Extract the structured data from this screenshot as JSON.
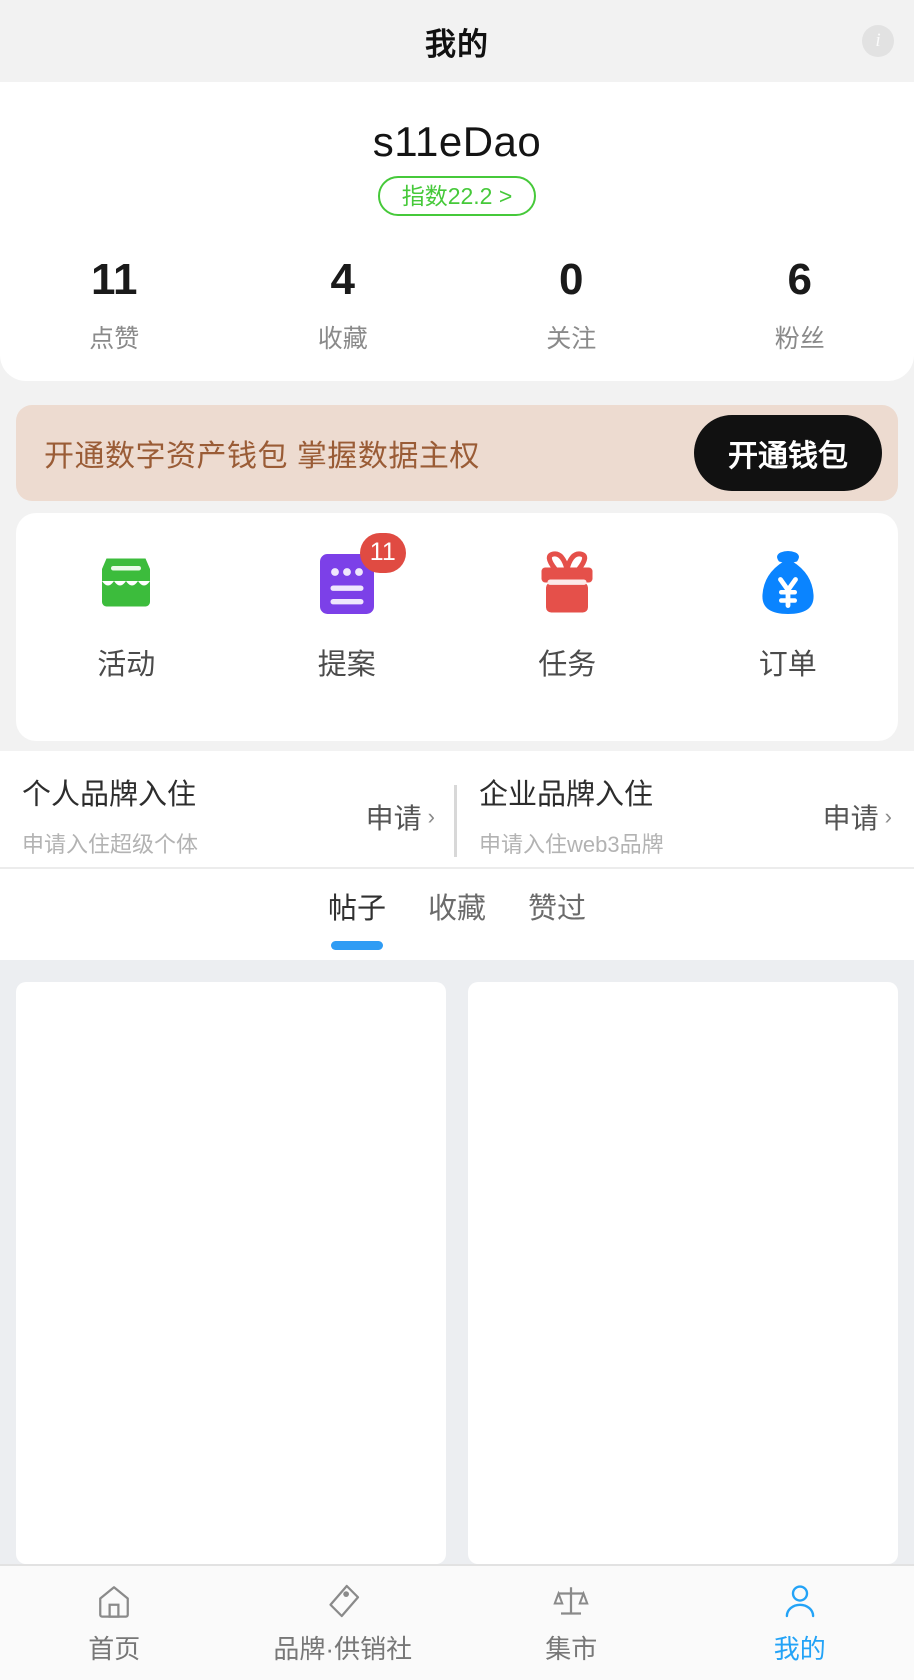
{
  "header": {
    "title": "我的",
    "info_icon": "info-icon"
  },
  "profile": {
    "username": "s11eDao",
    "index_badge": "指数22.2 >",
    "stats": [
      {
        "value": "11",
        "label": "点赞"
      },
      {
        "value": "4",
        "label": "收藏"
      },
      {
        "value": "0",
        "label": "关注"
      },
      {
        "value": "6",
        "label": "粉丝"
      }
    ]
  },
  "wallet_banner": {
    "text": "开通数字资产钱包 掌握数据主权",
    "button": "开通钱包",
    "bg_color": "#eddbd0",
    "text_color": "#9a5c36",
    "button_color": "#111111"
  },
  "quick_entries": [
    {
      "label": "活动",
      "icon": "store-icon",
      "color": "#3cbc3c",
      "badge": ""
    },
    {
      "label": "提案",
      "icon": "document-icon",
      "color": "#7c40e8",
      "badge": "11"
    },
    {
      "label": "任务",
      "icon": "gift-icon",
      "color": "#e5504a",
      "badge": ""
    },
    {
      "label": "订单",
      "icon": "money-bag-icon",
      "color": "#0a84ff",
      "badge": ""
    }
  ],
  "brand_entries": [
    {
      "title": "个人品牌入住",
      "subtitle": "申请入住超级个体",
      "apply_label": "申请",
      "chevron": "›"
    },
    {
      "title": "企业品牌入住",
      "subtitle": "申请入住web3品牌",
      "apply_label": "申请",
      "chevron": "›"
    }
  ],
  "tabs": [
    {
      "label": "帖子",
      "active": true
    },
    {
      "label": "收藏",
      "active": false
    },
    {
      "label": "赞过",
      "active": false
    }
  ],
  "tab_accent_color": "#2f9cf4",
  "content_cards": [
    {
      "placeholder": ""
    },
    {
      "placeholder": ""
    }
  ],
  "bottom_nav": {
    "active_color": "#23a3f7",
    "items": [
      {
        "label": "首页",
        "icon": "home-icon",
        "active": false
      },
      {
        "label": "品牌·供销社",
        "icon": "tag-icon",
        "active": false
      },
      {
        "label": "集市",
        "icon": "scales-icon",
        "active": false
      },
      {
        "label": "我的",
        "icon": "person-icon",
        "active": true
      }
    ]
  }
}
